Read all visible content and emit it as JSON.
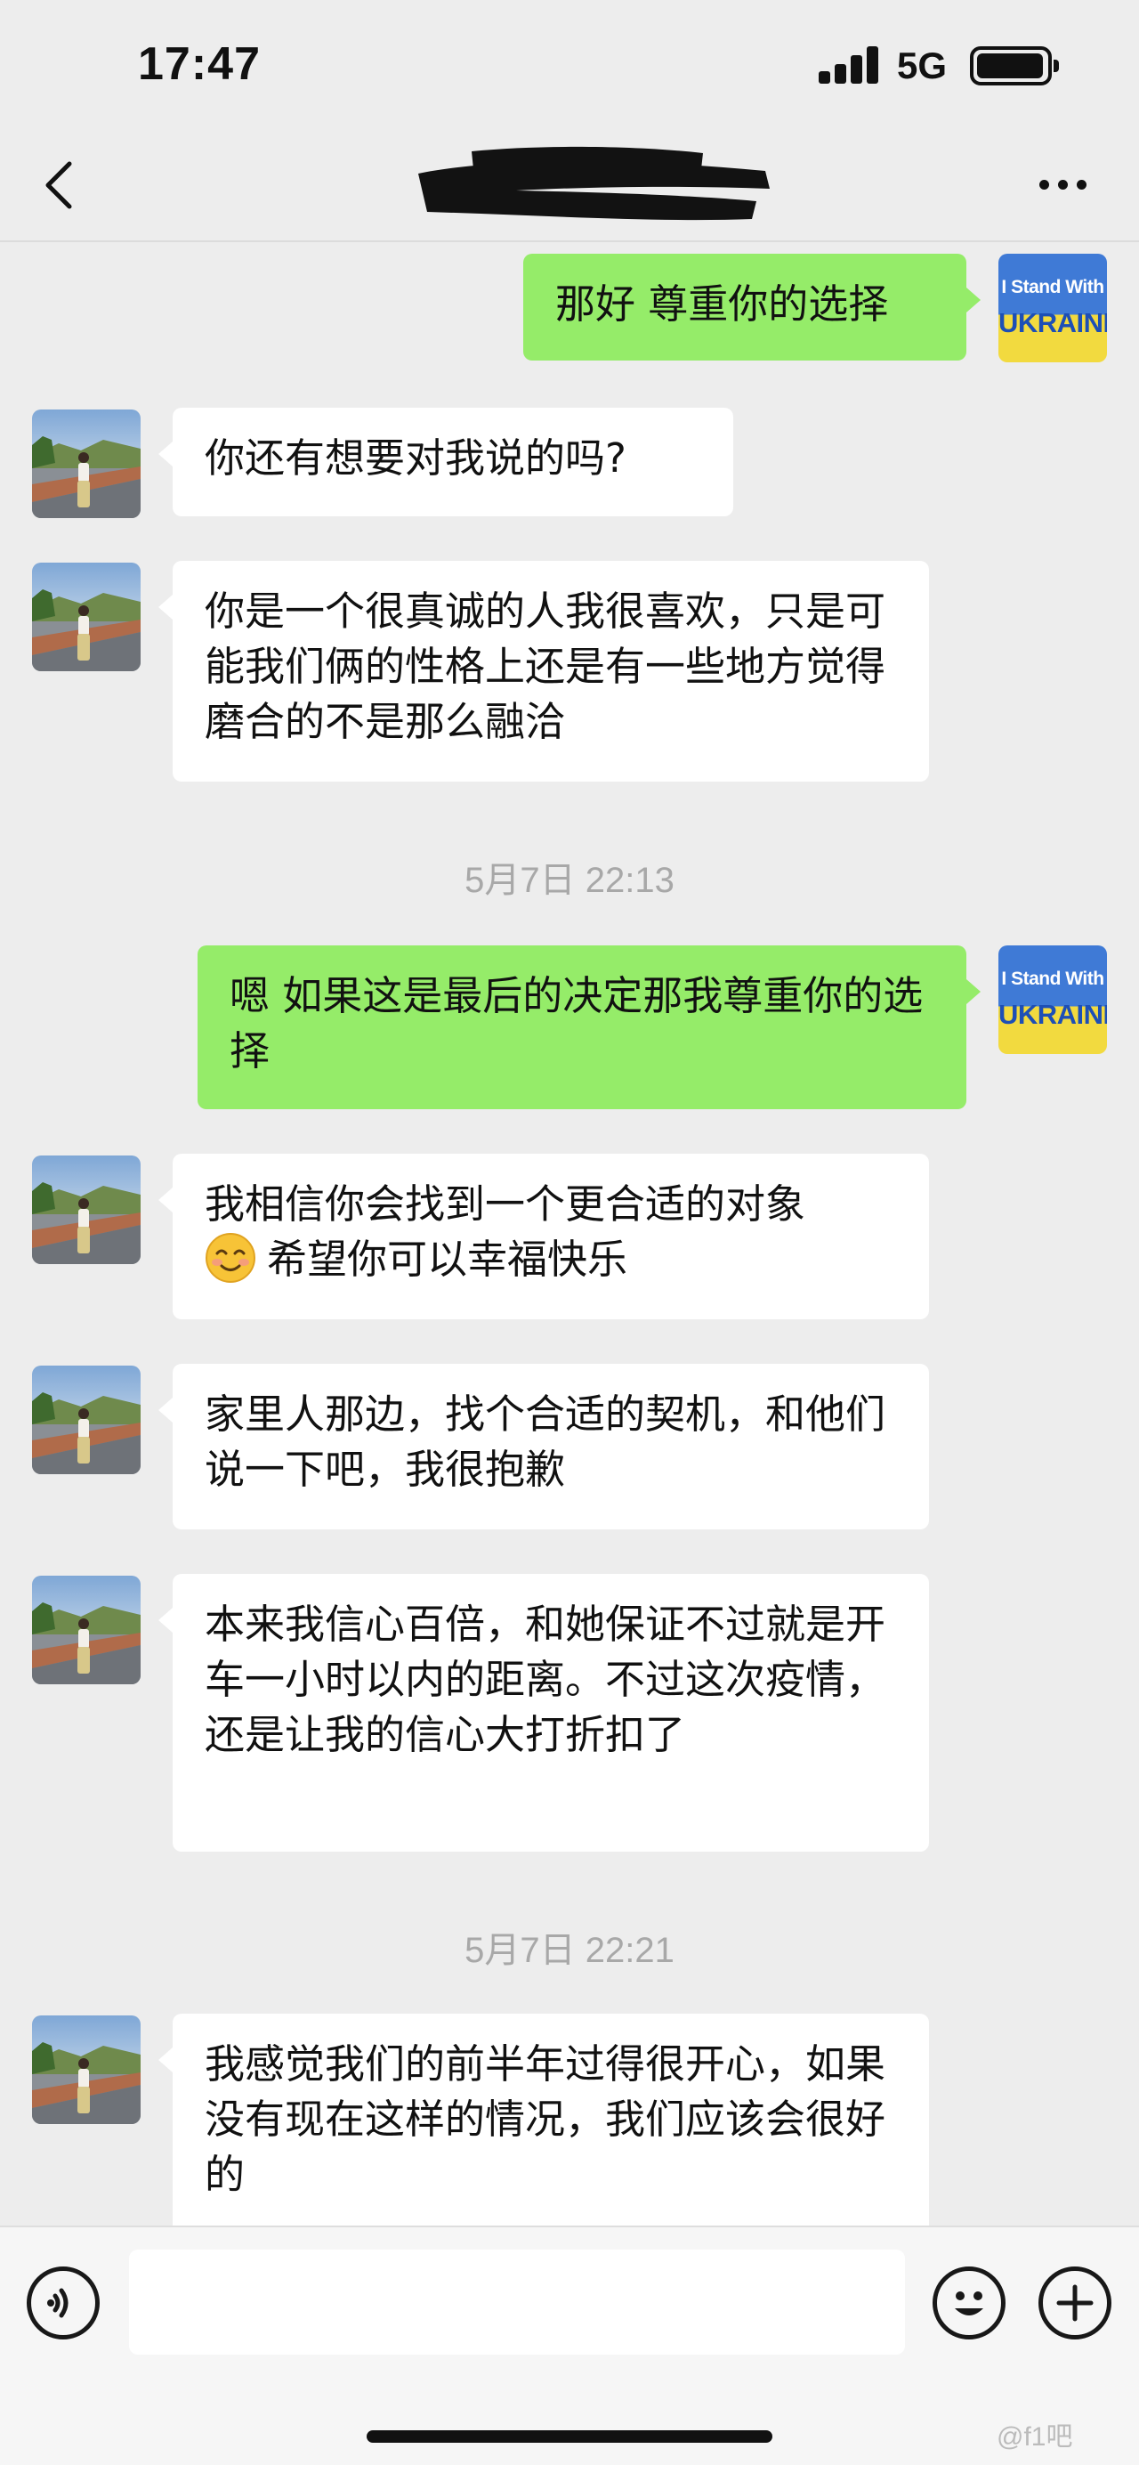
{
  "status_bar": {
    "time": "17:47",
    "network": "5G"
  },
  "nav": {
    "title": "",
    "title_redacted": true
  },
  "ukraine_badge": {
    "line1": "I Stand With",
    "line2": "UKRAINE"
  },
  "messages": [
    {
      "side": "out",
      "text": "那好 尊重你的选择"
    },
    {
      "side": "in",
      "text": "你还有想要对我说的吗?"
    },
    {
      "side": "in",
      "text": "你是一个很真诚的人我很喜欢，只是可能我们俩的性格上还是有一些地方觉得磨合的不是那么融洽"
    },
    {
      "type": "time",
      "text": "5月7日 22:13"
    },
    {
      "side": "out",
      "text": "嗯 如果这是最后的决定那我尊重你的选择"
    },
    {
      "side": "in",
      "text_before_emoji": "我相信你会找到一个更合适的对象",
      "emoji": "smiling-face",
      "text_after_emoji": "希望你可以幸福快乐"
    },
    {
      "side": "in",
      "text": "家里人那边，找个合适的契机，和他们说一下吧，我很抱歉"
    },
    {
      "side": "in",
      "text": "本来我信心百倍，和她保证不过就是开车一小时以内的距离。不过这次疫情，还是让我的信心大打折扣了"
    },
    {
      "type": "time",
      "text": "5月7日 22:21"
    },
    {
      "side": "in",
      "text": "我感觉我们的前半年过得很开心，如果没有现在这样的情况，我们应该会很好的"
    }
  ],
  "input_bar": {
    "placeholder": "",
    "icons": [
      "voice-icon",
      "emoji-icon",
      "plus-icon"
    ]
  },
  "watermark": "@f1吧",
  "colors": {
    "background": "#ededed",
    "bubble_out": "#95ec69",
    "bubble_in": "#ffffff",
    "timestamp": "#a8a8a8"
  }
}
